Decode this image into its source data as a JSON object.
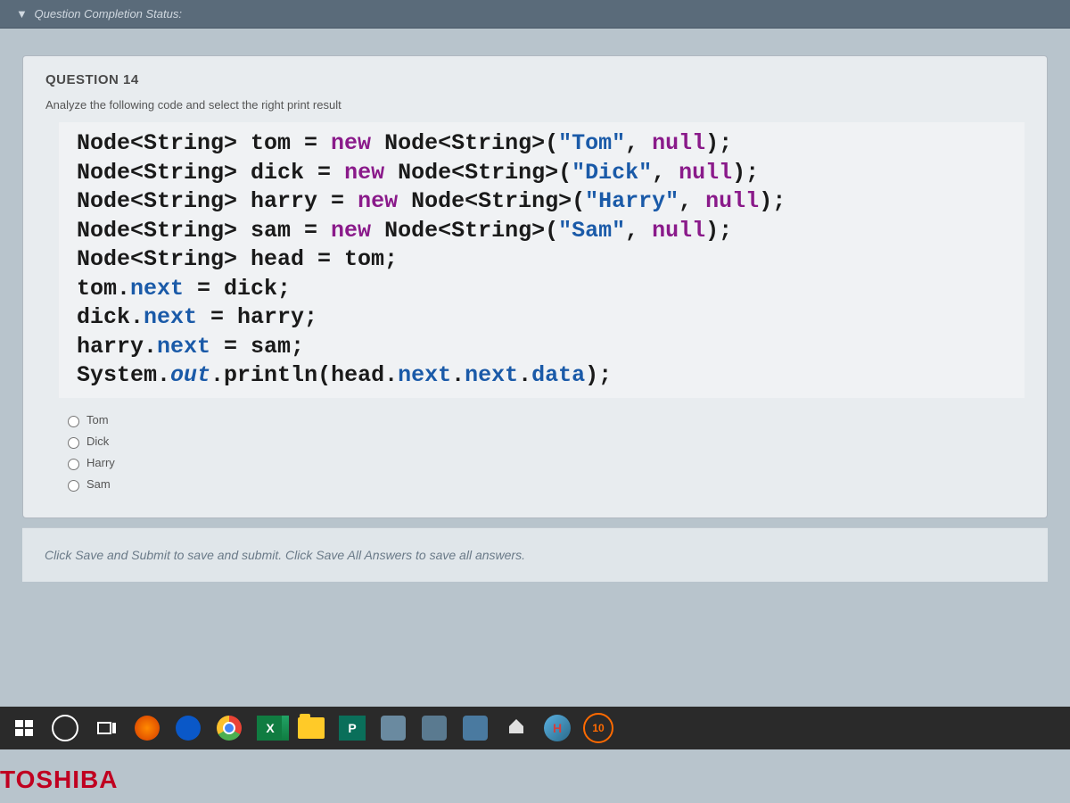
{
  "status_bar": {
    "arrow": "▼",
    "text": "Question Completion Status:"
  },
  "question": {
    "header": "QUESTION 14",
    "prompt": "Analyze the following code and select the right print result",
    "code_lines": [
      [
        {
          "t": "type",
          "v": "Node<String> tom = "
        },
        {
          "t": "kw",
          "v": "new"
        },
        {
          "t": "type",
          "v": " Node<String>("
        },
        {
          "t": "str",
          "v": "\"Tom\""
        },
        {
          "t": "type",
          "v": ", "
        },
        {
          "t": "kw",
          "v": "null"
        },
        {
          "t": "type",
          "v": ");"
        }
      ],
      [
        {
          "t": "type",
          "v": "Node<String> dick = "
        },
        {
          "t": "kw",
          "v": "new"
        },
        {
          "t": "type",
          "v": " Node<String>("
        },
        {
          "t": "str",
          "v": "\"Dick\""
        },
        {
          "t": "type",
          "v": ", "
        },
        {
          "t": "kw",
          "v": "null"
        },
        {
          "t": "type",
          "v": ");"
        }
      ],
      [
        {
          "t": "type",
          "v": "Node<String> harry = "
        },
        {
          "t": "kw",
          "v": "new"
        },
        {
          "t": "type",
          "v": " Node<String>("
        },
        {
          "t": "str",
          "v": "\"Harry\""
        },
        {
          "t": "type",
          "v": ", "
        },
        {
          "t": "kw",
          "v": "null"
        },
        {
          "t": "type",
          "v": ");"
        }
      ],
      [
        {
          "t": "type",
          "v": "Node<String> sam = "
        },
        {
          "t": "kw",
          "v": "new"
        },
        {
          "t": "type",
          "v": " Node<String>("
        },
        {
          "t": "str",
          "v": "\"Sam\""
        },
        {
          "t": "type",
          "v": ", "
        },
        {
          "t": "kw",
          "v": "null"
        },
        {
          "t": "type",
          "v": ");"
        }
      ],
      [
        {
          "t": "type",
          "v": "Node<String> head = tom;"
        }
      ],
      [
        {
          "t": "type",
          "v": "tom."
        },
        {
          "t": "field",
          "v": "next"
        },
        {
          "t": "type",
          "v": " = dick;"
        }
      ],
      [
        {
          "t": "type",
          "v": "dick."
        },
        {
          "t": "field",
          "v": "next"
        },
        {
          "t": "type",
          "v": " = harry;"
        }
      ],
      [
        {
          "t": "type",
          "v": "harry."
        },
        {
          "t": "field",
          "v": "next"
        },
        {
          "t": "type",
          "v": " = sam;"
        }
      ],
      [
        {
          "t": "type",
          "v": "System."
        },
        {
          "t": "field sys",
          "v": "out"
        },
        {
          "t": "type",
          "v": ".println(head."
        },
        {
          "t": "field",
          "v": "next"
        },
        {
          "t": "type",
          "v": "."
        },
        {
          "t": "field",
          "v": "next"
        },
        {
          "t": "type",
          "v": "."
        },
        {
          "t": "field",
          "v": "data"
        },
        {
          "t": "type",
          "v": ");"
        }
      ]
    ],
    "options": [
      "Tom",
      "Dick",
      "Harry",
      "Sam"
    ]
  },
  "footer_hint": "Click Save and Submit to save and submit. Click Save All Answers to save all answers.",
  "taskbar": {
    "excel_letter": "X",
    "pub_letter": "P",
    "h_letter": "H",
    "badge_number": "10"
  },
  "brand": "TOSHIBA"
}
